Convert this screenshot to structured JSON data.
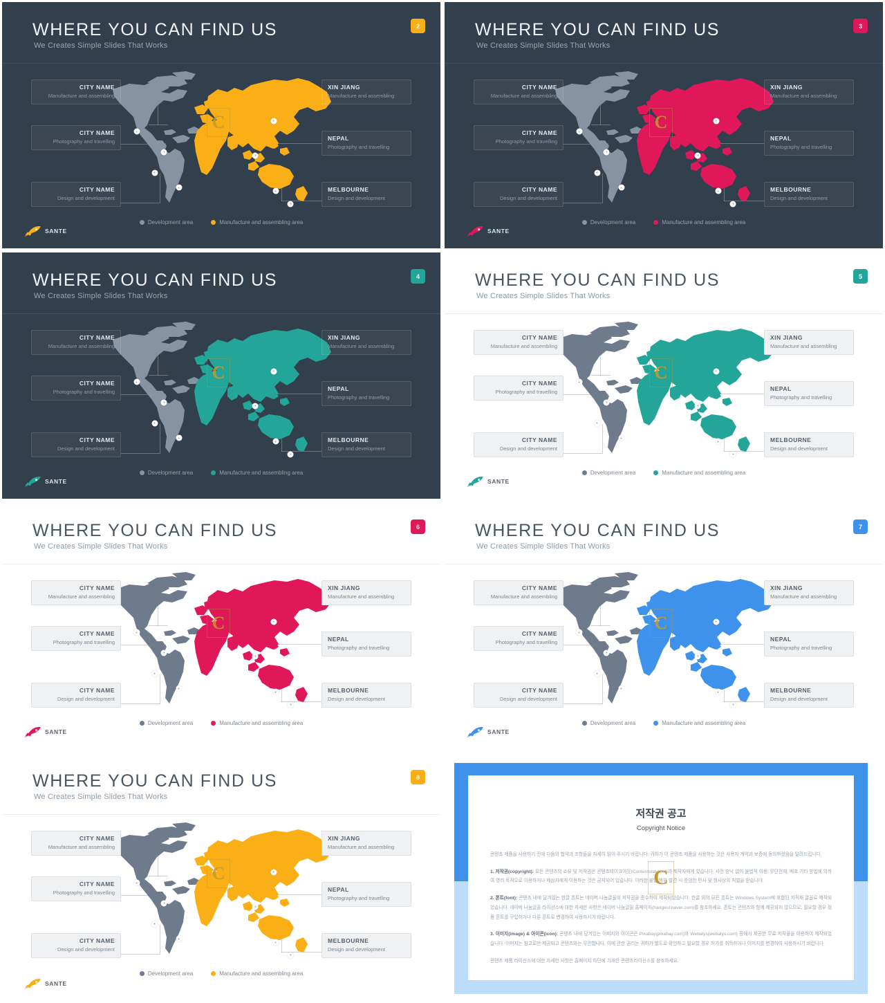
{
  "common": {
    "title": "WHERE YOU CAN FIND US",
    "subtitle": "We Creates Simple Slides That Works",
    "logo_name": "SANTE",
    "watermark_letter": "C",
    "legend": {
      "development": "Development area",
      "manufacture": "Manufacture and assembling area"
    },
    "labels_left": [
      {
        "title": "CITY NAME",
        "desc": "Manufacture and assembling"
      },
      {
        "title": "CITY NAME",
        "desc": "Photography and travelling"
      },
      {
        "title": "CITY NAME",
        "desc": "Design and development"
      }
    ],
    "labels_right": [
      {
        "title": "XIN JIANG",
        "desc": "Manufacture and assembling"
      },
      {
        "title": "NEPAL",
        "desc": "Photography and travelling"
      },
      {
        "title": "MELBOURNE",
        "desc": "Design and development"
      }
    ],
    "colors": {
      "dark_bg": "#323f4c",
      "light_bg": "#ffffff",
      "gray_region": "#7f8c9c",
      "gray_region_dark": "#8593a3",
      "orange": "#fbaf17",
      "crimson": "#e0185a",
      "teal": "#23a699",
      "blue": "#3f92ec"
    }
  },
  "slides": [
    {
      "number": "2",
      "theme": "dark",
      "accent": "#fbaf17",
      "region_gray": "#8593a3",
      "badge_text_color": "#ffffff"
    },
    {
      "number": "3",
      "theme": "dark",
      "accent": "#e0185a",
      "region_gray": "#8593a3",
      "badge_text_color": "#ffffff"
    },
    {
      "number": "4",
      "theme": "dark",
      "accent": "#23a699",
      "region_gray": "#8593a3",
      "badge_text_color": "#ffffff"
    },
    {
      "number": "5",
      "theme": "light",
      "accent": "#23a699",
      "region_gray": "#6d7b8c",
      "badge_text_color": "#ffffff"
    },
    {
      "number": "6",
      "theme": "light",
      "accent": "#e0185a",
      "region_gray": "#6d7b8c",
      "badge_text_color": "#ffffff"
    },
    {
      "number": "7",
      "theme": "light",
      "accent": "#3f92ec",
      "region_gray": "#6d7b8c",
      "badge_text_color": "#ffffff"
    },
    {
      "number": "8",
      "theme": "light",
      "accent": "#fbaf17",
      "region_gray": "#6d7b8c",
      "badge_text_color": "#ffffff"
    }
  ],
  "copyright": {
    "title_ko": "저작권 공고",
    "title_en": "Copyright Notice",
    "watermark_letter": "C",
    "paragraphs": [
      "콘텐츠 제품을 사용하기 전에 다음의 협약과 조항들을 자세히 읽어 주시기 바랍니다. 귀하가 이 콘텐츠 제품을 사용하는 것은 사용자 계약과 보증에 동의하셨음을 알려드립니다.",
      "1. 저작권(copyright): 모든 콘텐츠의 소유 및 저작권은 콘텐츠테이크아웃(Contentstakeout)과 제작자에게 있습니다. 사전 승낙 없이 불법적 이용, 무단전재, 배포 기타 방법에 의하여 영리 목적으로 이용하거나 제삼자에게 이용하는 것은 금지되어 있습니다. 이러한 불법 행위 발견 시 준엄한 민사 및 형사상의 처벌을 받습니다.",
      "2. 폰트(font): 콘텐츠 내에 담겨있는 한글 폰트는 네이버 나눔글꼴의 저작권을 준수하여 제작되었습니다. 한글 외의 모든 폰트는 Windows System에 포함된 지적재 글꼴로 제작되었습니다. 네이버 나눔글꼴 라이선스에 대한 자세한 사항은 네이버 나눔글꼴 홈페이지(hangeul.naver.com)를 참조하세요. 폰트는 콘텐츠와 함께 제공되지 않으므로, 필요할 경우 정품 폰트를 구입하거나 다른 폰트로 변경하여 사용하시기 바랍니다.",
      "3. 이미지(image) & 아이콘(icon): 콘텐츠 내에 담겨있는 이미지와 아이콘은 Pixabay(pixabay.com)와 Webalys(webalys.com) 등에서 제공한 무료 저작물을 이용하여 제작되었습니다. 이미지는 참고로만 제공되고 콘텐츠와는 무관합니다. 이에 관한 권리는 귀하가 별도로 확인하고 필요할 경우 허가를 취득하거나 이미지를 변경하여 사용하시기 바랍니다.",
      "콘텐츠 제품 라이선스에 대한 자세한 사항은 홈페이지 하단에 기재한 콘텐츠라이선스를 참조하세요."
    ]
  }
}
